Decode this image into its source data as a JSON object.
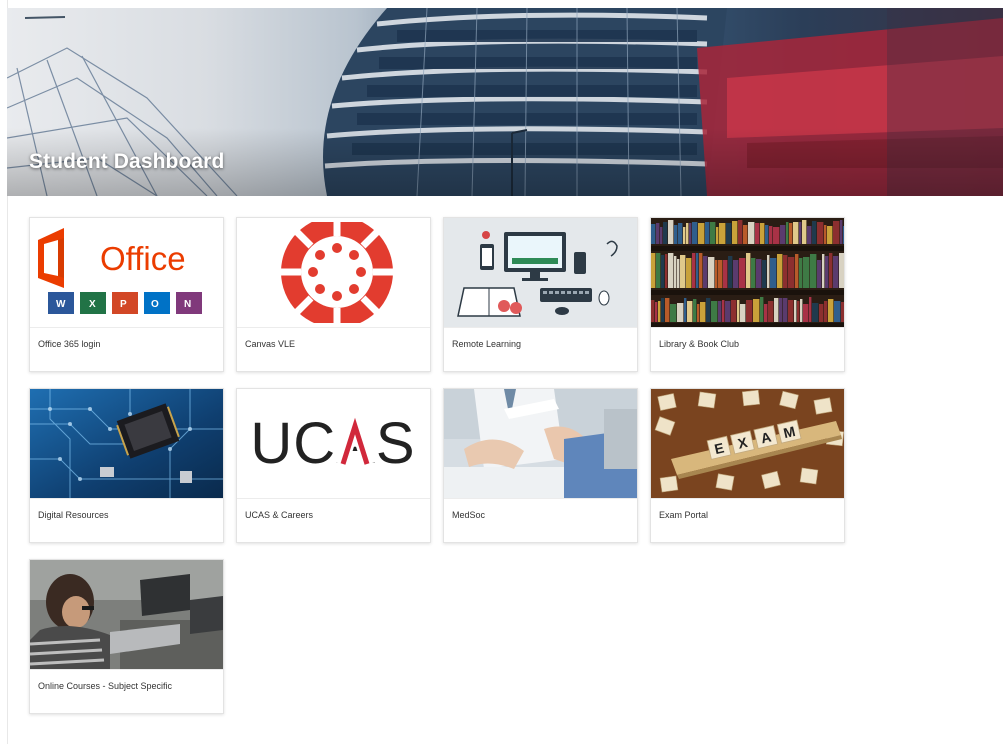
{
  "page": {
    "title": "Student Dashboard"
  },
  "tiles": [
    {
      "label": "Office 365 login"
    },
    {
      "label": "Canvas VLE"
    },
    {
      "label": "Remote Learning"
    },
    {
      "label": "Library & Book Club"
    },
    {
      "label": "Digital Resources"
    },
    {
      "label": "UCAS & Careers"
    },
    {
      "label": "MedSoc"
    },
    {
      "label": "Exam Portal"
    },
    {
      "label": "Online Courses - Subject Specific"
    }
  ],
  "logos": {
    "office": {
      "wordmark": "Office",
      "apps": [
        "W",
        "X",
        "P",
        "O",
        "N"
      ]
    },
    "ucas": {
      "wordmark": "UCAS"
    },
    "exam": {
      "tiles": [
        "E",
        "X",
        "A",
        "M"
      ]
    }
  },
  "colors": {
    "office_orange": "#eb3c00",
    "word_blue": "#2b579a",
    "excel_green": "#217346",
    "powerpoint_orange": "#d24726",
    "outlook_blue": "#0072c6",
    "onenote_purple": "#80397b",
    "canvas_red": "#e23c2f",
    "ucas_red": "#d1283b"
  }
}
